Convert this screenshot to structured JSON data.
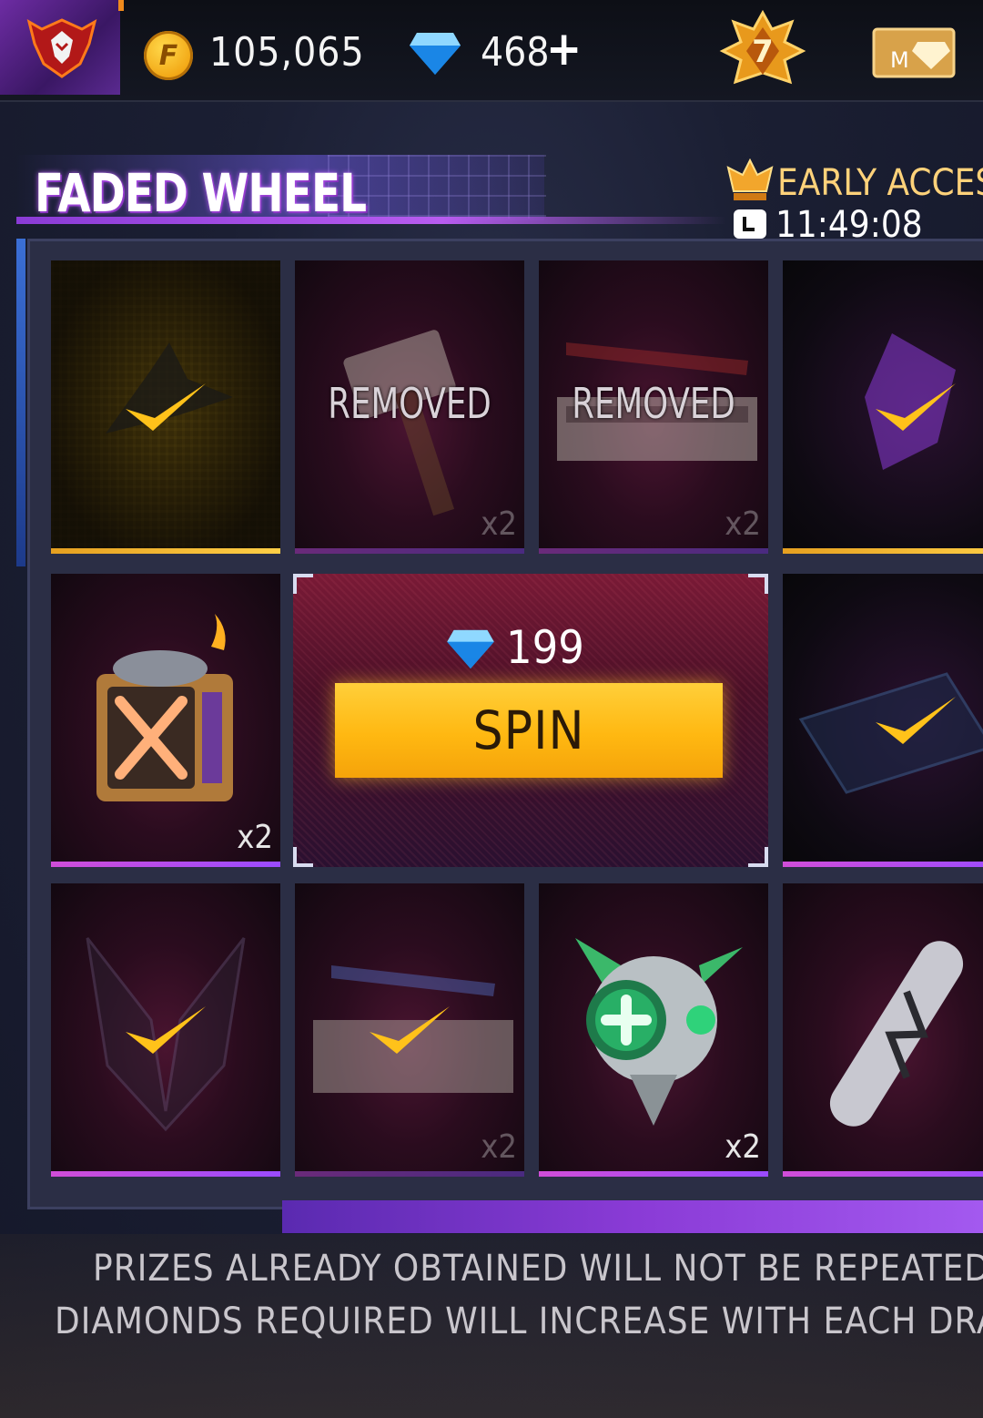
{
  "topbar": {
    "coin_symbol": "F",
    "coins": "105,065",
    "diamonds": "468",
    "plus": "+",
    "rank_level": "7",
    "membership_letter": "M"
  },
  "header": {
    "title": "FADED WHEEL",
    "badge": "EARLY ACCES",
    "timer": "11:49:08"
  },
  "tiles": [
    {
      "name": "tile-1",
      "obtained": true
    },
    {
      "name": "tile-2",
      "label": "REMOVED",
      "qty": "x2"
    },
    {
      "name": "tile-3",
      "label": "REMOVED",
      "qty": "x2"
    },
    {
      "name": "tile-4",
      "obtained": true
    },
    {
      "name": "tile-5",
      "qty": "x2"
    },
    {
      "name": "tile-6",
      "obtained": true
    },
    {
      "name": "tile-7",
      "obtained": true
    },
    {
      "name": "tile-8",
      "obtained": true,
      "qty": "x2"
    },
    {
      "name": "tile-9",
      "qty": "x2"
    },
    {
      "name": "tile-10"
    }
  ],
  "spin": {
    "cost": "199",
    "label": "SPIN"
  },
  "notes": {
    "line1": "PRIZES ALREADY OBTAINED WILL NOT BE REPEATED.",
    "line2": "DIAMONDS REQUIRED WILL INCREASE WITH EACH DRAW"
  },
  "colors": {
    "accent_purple": "#9a4bff",
    "spin_yellow": "#ffb811",
    "check_gold": "#ffc21a"
  }
}
